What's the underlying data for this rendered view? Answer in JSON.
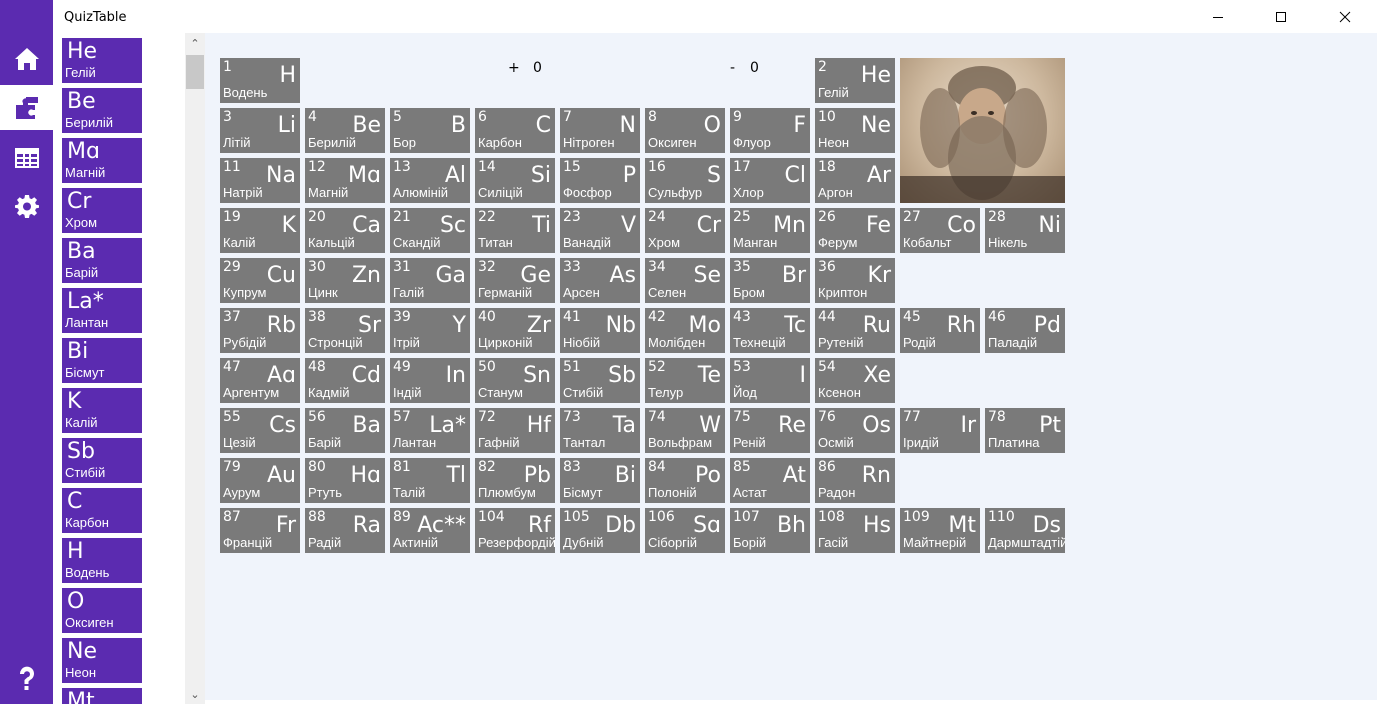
{
  "window": {
    "title": "QuizTable"
  },
  "nav": {
    "items": [
      "home-icon",
      "puzzle-icon",
      "table-icon",
      "gear-icon"
    ],
    "help": "help-icon",
    "accent": "#5b2bb0"
  },
  "quiz_list": [
    {
      "symbol": "He",
      "name": "Гелій"
    },
    {
      "symbol": "Be",
      "name": "Берилій"
    },
    {
      "symbol": "Mɑ",
      "name": "Магній"
    },
    {
      "symbol": "Cr",
      "name": "Хром"
    },
    {
      "symbol": "Ba",
      "name": "Барій"
    },
    {
      "symbol": "La*",
      "name": "Лантан"
    },
    {
      "symbol": "Bi",
      "name": "Бісмут"
    },
    {
      "symbol": "K",
      "name": "Калій"
    },
    {
      "symbol": "Sb",
      "name": "Стибій"
    },
    {
      "symbol": "C",
      "name": "Карбон"
    },
    {
      "symbol": "H",
      "name": "Водень"
    },
    {
      "symbol": "O",
      "name": "Оксиген"
    },
    {
      "symbol": "Ne",
      "name": "Неон"
    },
    {
      "symbol": "Mt",
      "name": ""
    }
  ],
  "scores": {
    "plus_label": "+",
    "plus_value": "0",
    "minus_label": "-",
    "minus_value": "0"
  },
  "elements": [
    {
      "num": "1",
      "symbol": "H",
      "name": "Водень"
    },
    {
      "num": "2",
      "symbol": "He",
      "name": "Гелій"
    },
    {
      "num": "3",
      "symbol": "Li",
      "name": "Літій"
    },
    {
      "num": "4",
      "symbol": "Be",
      "name": "Берилій"
    },
    {
      "num": "5",
      "symbol": "B",
      "name": "Бор"
    },
    {
      "num": "6",
      "symbol": "C",
      "name": "Карбон"
    },
    {
      "num": "7",
      "symbol": "N",
      "name": "Нітроген"
    },
    {
      "num": "8",
      "symbol": "O",
      "name": "Оксиген"
    },
    {
      "num": "9",
      "symbol": "F",
      "name": "Флуор"
    },
    {
      "num": "10",
      "symbol": "Ne",
      "name": "Неон"
    },
    {
      "num": "11",
      "symbol": "Na",
      "name": "Натрій"
    },
    {
      "num": "12",
      "symbol": "Mɑ",
      "name": "Магній"
    },
    {
      "num": "13",
      "symbol": "Al",
      "name": "Алюміній"
    },
    {
      "num": "14",
      "symbol": "Si",
      "name": "Силіцій"
    },
    {
      "num": "15",
      "symbol": "P",
      "name": "Фосфор"
    },
    {
      "num": "16",
      "symbol": "S",
      "name": "Сульфур"
    },
    {
      "num": "17",
      "symbol": "Cl",
      "name": "Хлор"
    },
    {
      "num": "18",
      "symbol": "Ar",
      "name": "Аргон"
    },
    {
      "num": "19",
      "symbol": "K",
      "name": "Калій"
    },
    {
      "num": "20",
      "symbol": "Ca",
      "name": "Кальцій"
    },
    {
      "num": "21",
      "symbol": "Sc",
      "name": "Скандій"
    },
    {
      "num": "22",
      "symbol": "Ti",
      "name": "Титан"
    },
    {
      "num": "23",
      "symbol": "V",
      "name": "Ванадій"
    },
    {
      "num": "24",
      "symbol": "Cr",
      "name": "Хром"
    },
    {
      "num": "25",
      "symbol": "Mn",
      "name": "Манган"
    },
    {
      "num": "26",
      "symbol": "Fe",
      "name": "Ферум"
    },
    {
      "num": "27",
      "symbol": "Co",
      "name": "Кобальт"
    },
    {
      "num": "28",
      "symbol": "Ni",
      "name": "Нікель"
    },
    {
      "num": "29",
      "symbol": "Cu",
      "name": "Купрум"
    },
    {
      "num": "30",
      "symbol": "Zn",
      "name": "Цинк"
    },
    {
      "num": "31",
      "symbol": "Ga",
      "name": "Галій"
    },
    {
      "num": "32",
      "symbol": "Ge",
      "name": "Германій"
    },
    {
      "num": "33",
      "symbol": "As",
      "name": "Арсен"
    },
    {
      "num": "34",
      "symbol": "Se",
      "name": "Селен"
    },
    {
      "num": "35",
      "symbol": "Br",
      "name": "Бром"
    },
    {
      "num": "36",
      "symbol": "Kr",
      "name": "Криптон"
    },
    {
      "num": "37",
      "symbol": "Rb",
      "name": "Рубідій"
    },
    {
      "num": "38",
      "symbol": "Sr",
      "name": "Стронцій"
    },
    {
      "num": "39",
      "symbol": "Y",
      "name": "Ітрій"
    },
    {
      "num": "40",
      "symbol": "Zr",
      "name": "Цирконій"
    },
    {
      "num": "41",
      "symbol": "Nb",
      "name": "Ніобій"
    },
    {
      "num": "42",
      "symbol": "Mo",
      "name": "Молібден"
    },
    {
      "num": "43",
      "symbol": "Tc",
      "name": "Технецій"
    },
    {
      "num": "44",
      "symbol": "Ru",
      "name": "Рутеній"
    },
    {
      "num": "45",
      "symbol": "Rh",
      "name": "Родій"
    },
    {
      "num": "46",
      "symbol": "Pd",
      "name": "Паладій"
    },
    {
      "num": "47",
      "symbol": "Aɑ",
      "name": "Аргентум"
    },
    {
      "num": "48",
      "symbol": "Cd",
      "name": "Кадмій"
    },
    {
      "num": "49",
      "symbol": "In",
      "name": "Індій"
    },
    {
      "num": "50",
      "symbol": "Sn",
      "name": "Станум"
    },
    {
      "num": "51",
      "symbol": "Sb",
      "name": "Стибій"
    },
    {
      "num": "52",
      "symbol": "Te",
      "name": "Телур"
    },
    {
      "num": "53",
      "symbol": "I",
      "name": "Йод"
    },
    {
      "num": "54",
      "symbol": "Xe",
      "name": "Ксенон"
    },
    {
      "num": "55",
      "symbol": "Cs",
      "name": "Цезій"
    },
    {
      "num": "56",
      "symbol": "Ba",
      "name": "Барій"
    },
    {
      "num": "57",
      "symbol": "La*",
      "name": "Лантан"
    },
    {
      "num": "72",
      "symbol": "Hf",
      "name": "Гафній"
    },
    {
      "num": "73",
      "symbol": "Ta",
      "name": "Тантал"
    },
    {
      "num": "74",
      "symbol": "W",
      "name": "Вольфрам"
    },
    {
      "num": "75",
      "symbol": "Re",
      "name": "Реній"
    },
    {
      "num": "76",
      "symbol": "Os",
      "name": "Осмій"
    },
    {
      "num": "77",
      "symbol": "Ir",
      "name": "Іридій"
    },
    {
      "num": "78",
      "symbol": "Pt",
      "name": "Платина"
    },
    {
      "num": "79",
      "symbol": "Au",
      "name": "Аурум"
    },
    {
      "num": "80",
      "symbol": "Hɑ",
      "name": "Ртуть"
    },
    {
      "num": "81",
      "symbol": "Tl",
      "name": "Талій"
    },
    {
      "num": "82",
      "symbol": "Pb",
      "name": "Плюмбум"
    },
    {
      "num": "83",
      "symbol": "Bi",
      "name": "Бісмут"
    },
    {
      "num": "84",
      "symbol": "Po",
      "name": "Полоній"
    },
    {
      "num": "85",
      "symbol": "At",
      "name": "Астат"
    },
    {
      "num": "86",
      "symbol": "Rn",
      "name": "Радон"
    },
    {
      "num": "87",
      "symbol": "Fr",
      "name": "Францій"
    },
    {
      "num": "88",
      "symbol": "Ra",
      "name": "Радій"
    },
    {
      "num": "89",
      "symbol": "Ac**",
      "name": "Актиній"
    },
    {
      "num": "104",
      "symbol": "Rf",
      "name": "Резерфордій"
    },
    {
      "num": "105",
      "symbol": "Db",
      "name": "Дубній"
    },
    {
      "num": "106",
      "symbol": "Sɑ",
      "name": "Сіборгій"
    },
    {
      "num": "107",
      "symbol": "Bh",
      "name": "Борій"
    },
    {
      "num": "108",
      "symbol": "Hs",
      "name": "Гасій"
    },
    {
      "num": "109",
      "symbol": "Mt",
      "name": "Майтнерій"
    },
    {
      "num": "110",
      "symbol": "Ds",
      "name": "Дармштадтій"
    }
  ]
}
